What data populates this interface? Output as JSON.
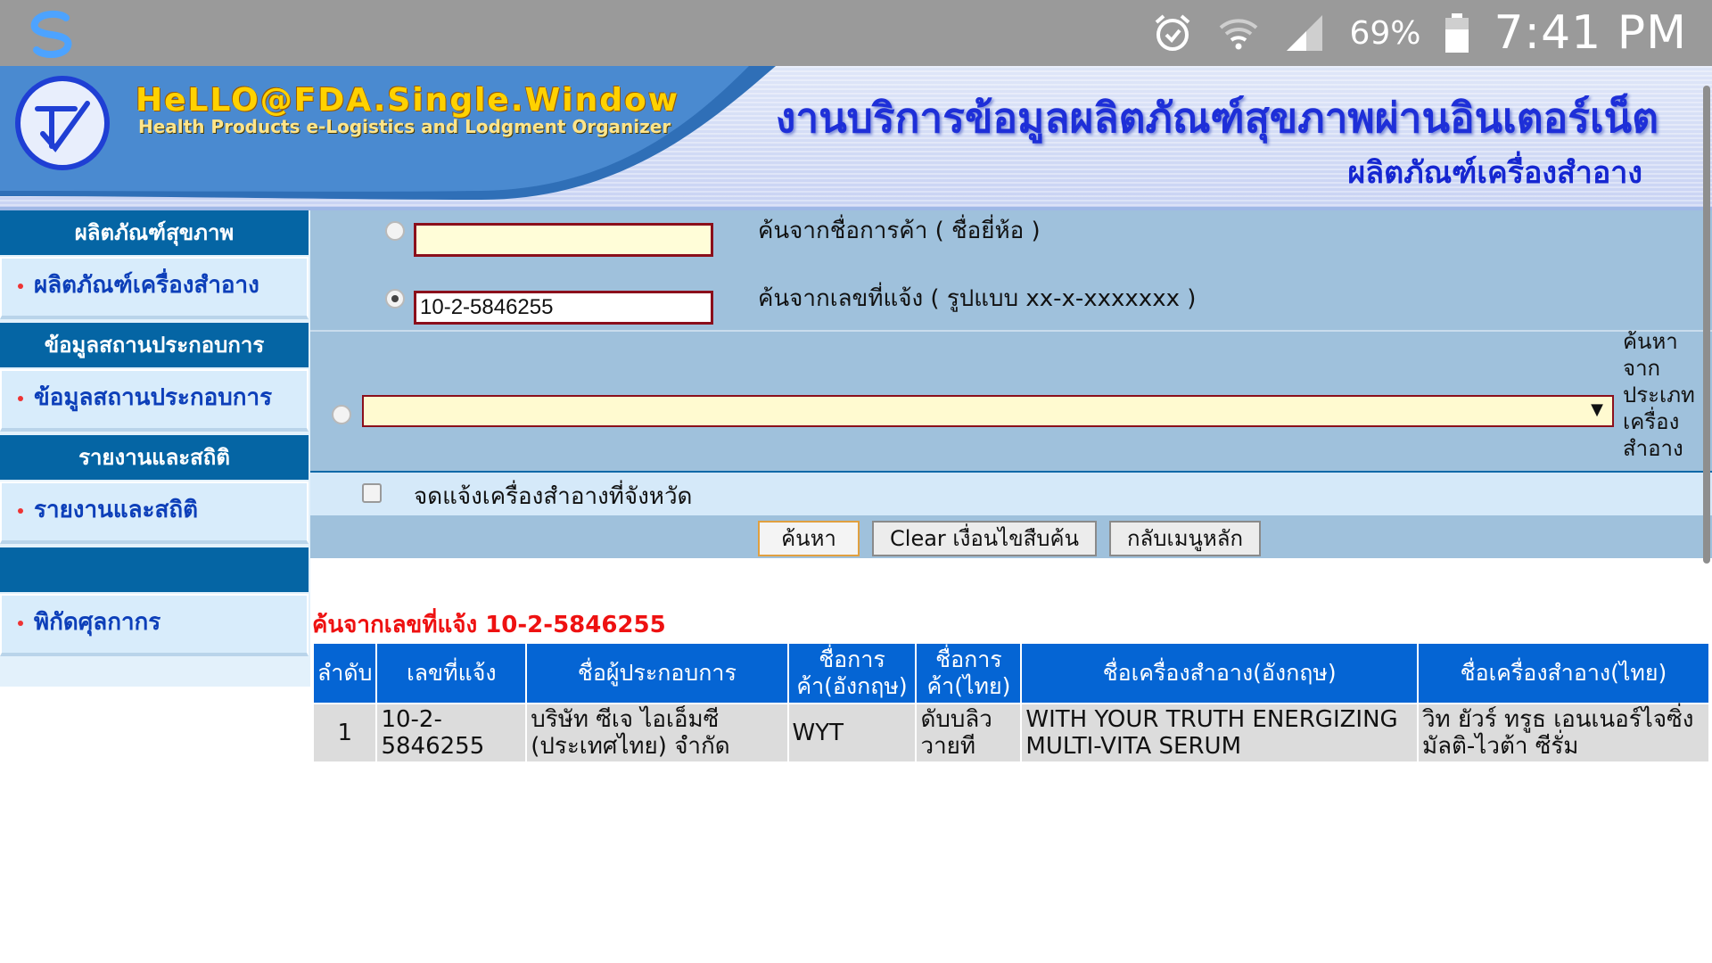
{
  "status_bar": {
    "battery_percent": "69%",
    "time": "7:41 PM",
    "icons": [
      "alarm-icon",
      "wifi-icon",
      "signal-icon",
      "battery-icon"
    ]
  },
  "banner": {
    "brand": "HeLLO@FDA.Single.Window",
    "brand_sub": "Health Products e-Logistics and Lodgment Organizer",
    "title": "งานบริการข้อมูลผลิตภัณฑ์สุขภาพผ่านอินเตอร์เน็ต",
    "subtitle": "ผลิตภัณฑ์เครื่องสำอาง"
  },
  "sidebar": {
    "sections": [
      {
        "header": "ผลิตภัณฑ์สุขภาพ",
        "item": "ผลิตภัณฑ์เครื่องสำอาง"
      },
      {
        "header": "ข้อมูลสถานประกอบการ",
        "item": "ข้อมูลสถานประกอบการ"
      },
      {
        "header": "รายงานและสถิติ",
        "item": "รายงานและสถิติ"
      },
      {
        "header": "",
        "item": "พิกัดศุลกากร"
      }
    ]
  },
  "search_form": {
    "brand_search": {
      "label": "ค้นจากชื่อการค้า ( ชื่อยี่ห้อ )",
      "value": ""
    },
    "notify_search": {
      "label": "ค้นจากเลขที่แจ้ง ( รูปแบบ xx-x-xxxxxxx )",
      "value": "10-2-5846255"
    },
    "type_search": {
      "caption": "ค้นหาจากประเภทเครื่องสำอาง",
      "selected": ""
    },
    "province_checkbox_label": "จดแจ้งเครื่องสำอางที่จังหวัด",
    "buttons": {
      "search": "ค้นหา",
      "clear": "Clear เงื่อนไขสืบค้น",
      "back": "กลับเมนูหลัก"
    }
  },
  "results": {
    "caption": "ค้นจากเลขที่แจ้ง 10-2-5846255",
    "columns": [
      "ลำดับ",
      "เลขที่แจ้ง",
      "ชื่อผู้ประกอบการ",
      "ชื่อการค้า(อังกฤษ)",
      "ชื่อการค้า(ไทย)",
      "ชื่อเครื่องสำอาง(อังกฤษ)",
      "ชื่อเครื่องสำอาง(ไทย)"
    ],
    "rows": [
      [
        "1",
        "10-2-5846255",
        "บริษัท ซีเจ ไอเอ็มซี (ประเทศไทย) จำกัด",
        "WYT",
        "ดับบลิววายที",
        "WITH YOUR TRUTH ENERGIZING MULTI-VITA SERUM",
        "วิท ยัวร์ ทรูธ เอนเนอร์ไจซิ่ง มัลติ-ไวต้า ซีรั่ม"
      ]
    ]
  }
}
